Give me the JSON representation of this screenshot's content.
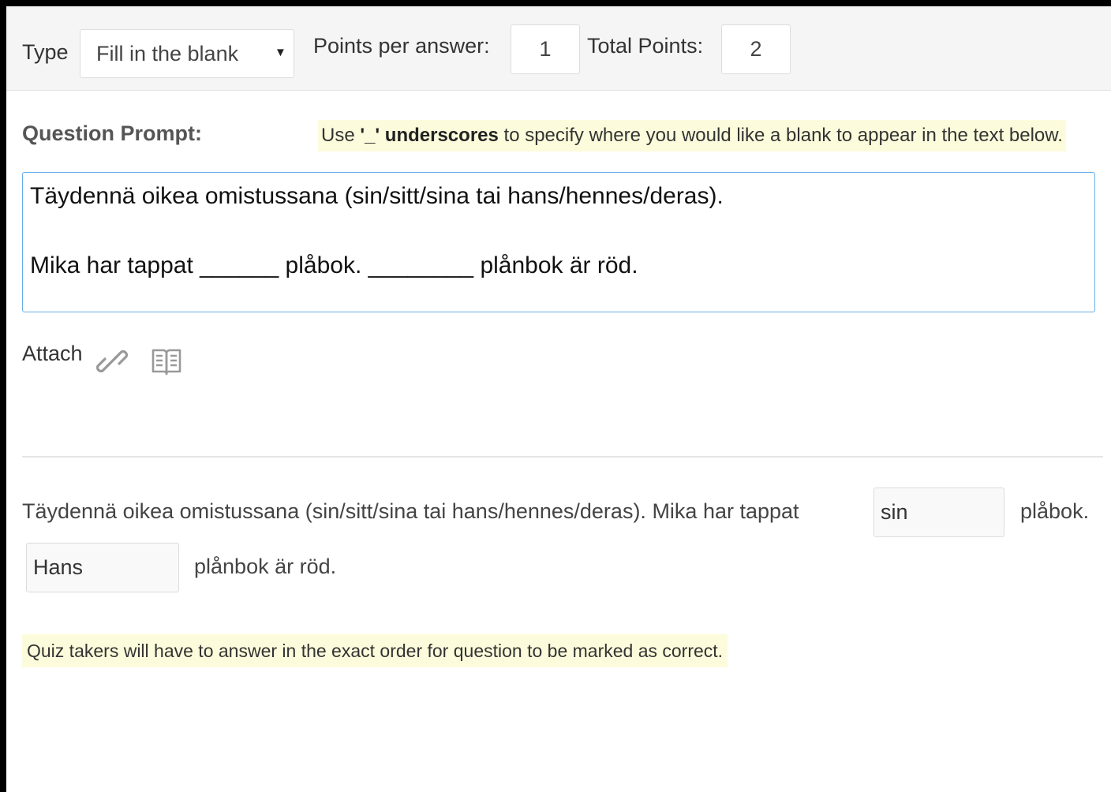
{
  "toolbar": {
    "type_label": "Type",
    "type_value": "Fill in the blank",
    "points_per_answer_label": "Points per answer:",
    "points_per_answer_value": "1",
    "total_points_label": "Total Points:",
    "total_points_value": "2"
  },
  "prompt": {
    "label": "Question Prompt:",
    "hint_pre": "Use ",
    "hint_bold": "'_' underscores",
    "hint_post": " to specify where you would like a blank to appear in the text below.",
    "text_line1": "Täydennä oikea omistussana (sin/sitt/sina tai hans/hennes/deras).",
    "text_line2": "Mika har tappat ______ plåbok. ________ plånbok är röd."
  },
  "attach": {
    "label": "Attach",
    "icons": [
      "link-icon",
      "book-icon"
    ]
  },
  "preview": {
    "sentence_part1": "Täydennä oikea omistussana (sin/sitt/sina tai hans/hennes/deras). Mika har tappat",
    "blank1_value": "sin",
    "sentence_part2": "plåbok.",
    "blank2_value": "Hans",
    "sentence_part3": "plånbok är röd."
  },
  "note": "Quiz takers will have to answer in the exact order for question to be marked as correct."
}
